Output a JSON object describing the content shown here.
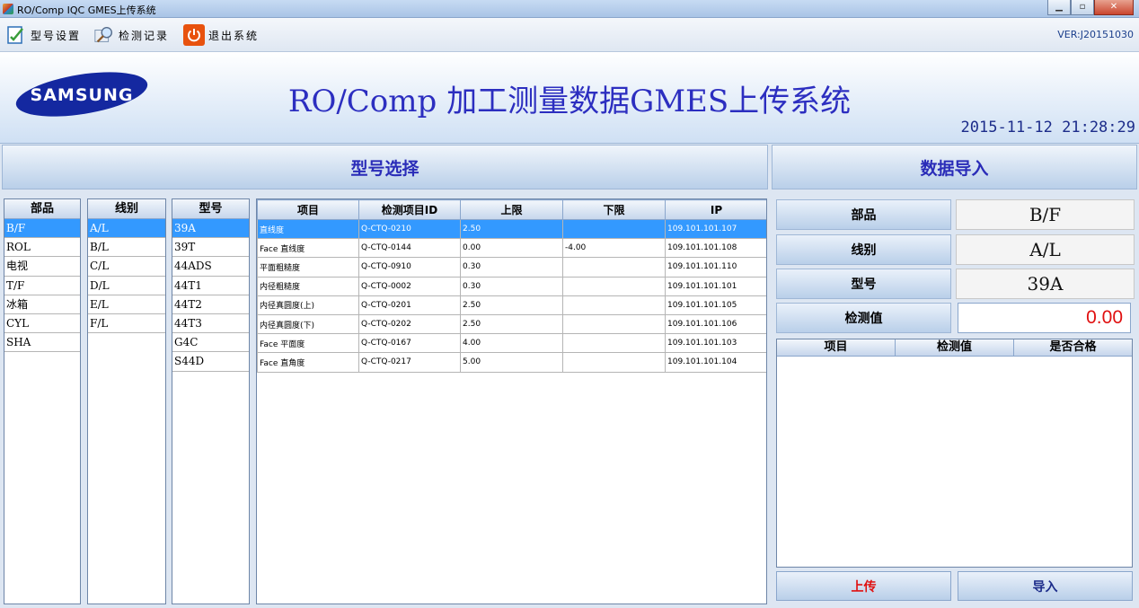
{
  "window": {
    "title": "RO/Comp IQC GMES上传系统"
  },
  "toolbar": {
    "model_settings": "型号设置",
    "inspection_records": "检测记录",
    "exit_system": "退出系统",
    "version": "VER:J20151030"
  },
  "banner": {
    "logo_text": "SAMSUNG",
    "title": "RO/Comp 加工测量数据GMES上传系统",
    "datetime": "2015-11-12 21:28:29"
  },
  "sections": {
    "model_select": "型号选择",
    "data_import": "数据导入"
  },
  "parts": {
    "header": "部品",
    "items": [
      "B/F",
      "ROL",
      "电视",
      "T/F",
      "冰箱",
      "CYL",
      "SHA"
    ],
    "selected": 0
  },
  "lines": {
    "header": "线别",
    "items": [
      "A/L",
      "B/L",
      "C/L",
      "D/L",
      "E/L",
      "F/L"
    ],
    "selected": 0
  },
  "models": {
    "header": "型号",
    "items": [
      "39A",
      "39T",
      "44ADS",
      "44T1",
      "44T2",
      "44T3",
      "G4C",
      "S44D"
    ],
    "selected": 0
  },
  "items_table": {
    "columns": [
      "项目",
      "检测项目ID",
      "上限",
      "下限",
      "IP"
    ],
    "rows": [
      [
        "直线度",
        "Q-CTQ-0210",
        "2.50",
        "",
        "109.101.101.107"
      ],
      [
        "Face 直线度",
        "Q-CTQ-0144",
        "0.00",
        "-4.00",
        "109.101.101.108"
      ],
      [
        "平面粗糙度",
        "Q-CTQ-0910",
        "0.30",
        "",
        "109.101.101.110"
      ],
      [
        "内径粗糙度",
        "Q-CTQ-0002",
        "0.30",
        "",
        "109.101.101.101"
      ],
      [
        "内径真圆度(上)",
        "Q-CTQ-0201",
        "2.50",
        "",
        "109.101.101.105"
      ],
      [
        "内径真圆度(下)",
        "Q-CTQ-0202",
        "2.50",
        "",
        "109.101.101.106"
      ],
      [
        "Face 平面度",
        "Q-CTQ-0167",
        "4.00",
        "",
        "109.101.101.103"
      ],
      [
        "Face 直角度",
        "Q-CTQ-0217",
        "5.00",
        "",
        "109.101.101.104"
      ]
    ],
    "selected": 0
  },
  "import_panel": {
    "part_label": "部品",
    "part_value": "B/F",
    "line_label": "线别",
    "line_value": "A/L",
    "model_label": "型号",
    "model_value": "39A",
    "measure_label": "检测值",
    "measure_value": "0.00",
    "result_columns": [
      "项目",
      "检测值",
      "是否合格"
    ],
    "upload_button": "上传",
    "import_button": "导入"
  },
  "colors": {
    "title_blue": "#2c2ec0",
    "selection": "#3399ff",
    "upload_red": "#e01010",
    "import_blue": "#1c2c8a"
  }
}
